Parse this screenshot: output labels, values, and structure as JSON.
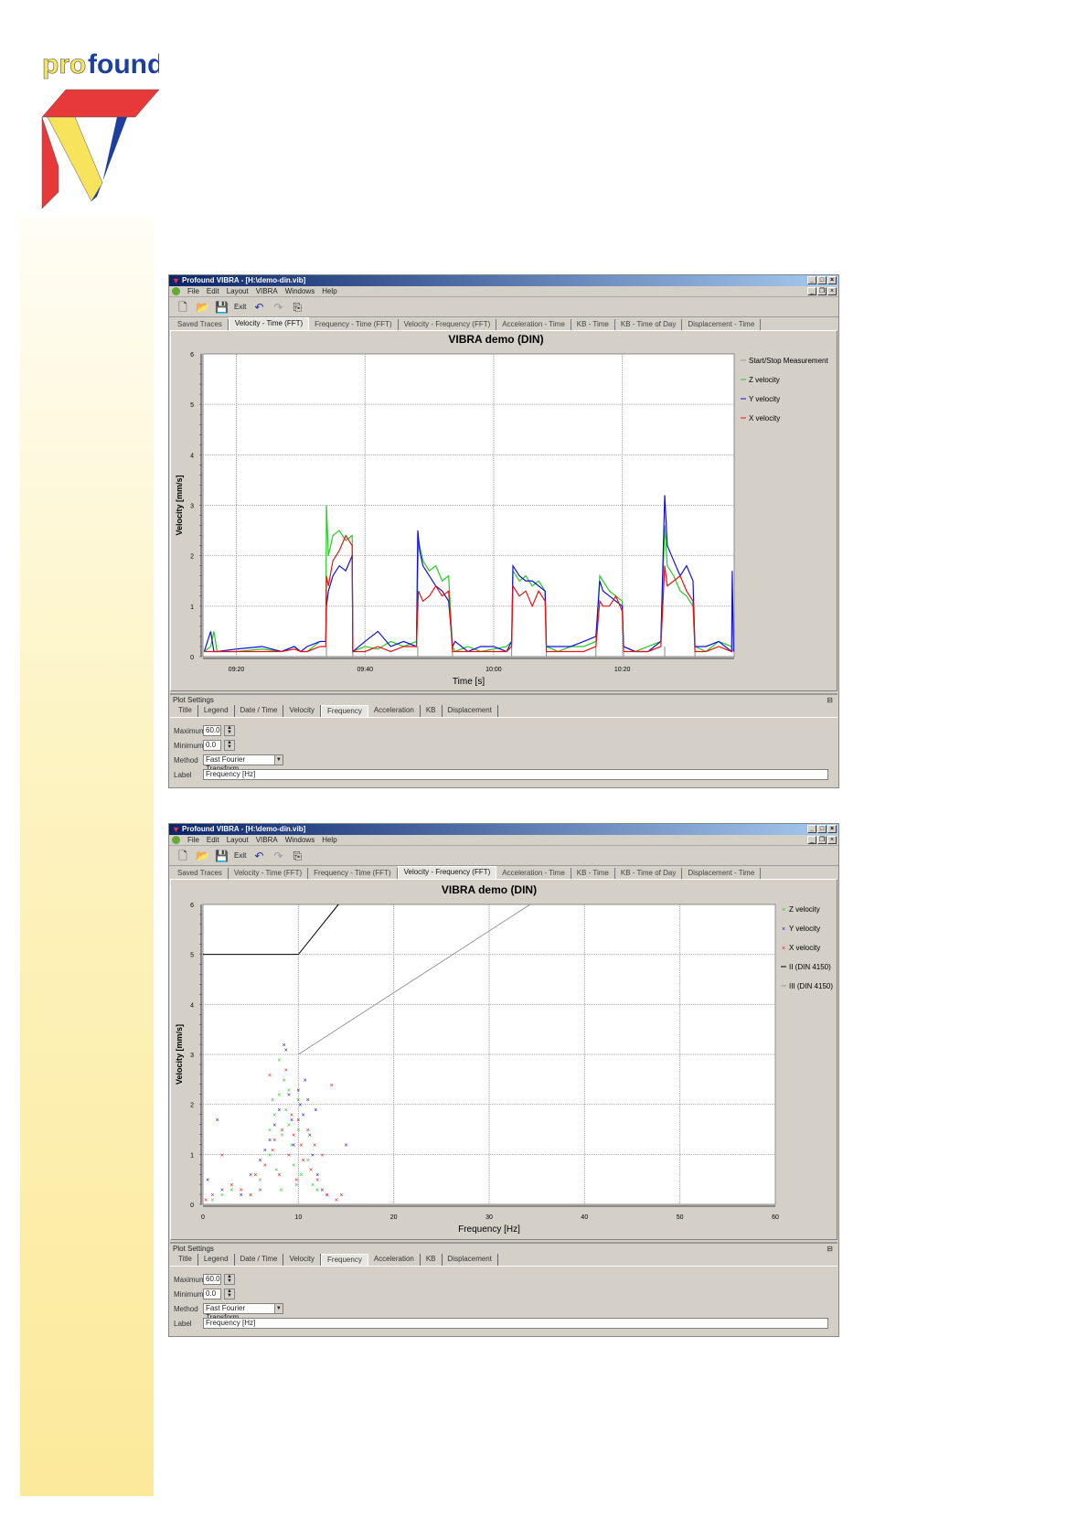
{
  "logo": {
    "text_pro": "pro",
    "text_found": "found"
  },
  "colors": {
    "z": "#22cc22",
    "y": "#1010dd",
    "x": "#ee1111",
    "title_bar": "#0a246a",
    "panel": "#d4d0c8"
  },
  "windows": [
    {
      "title": "Profound VIBRA - [H:\\demo-din.vib]",
      "menu": [
        "File",
        "Edit",
        "Layout",
        "VIBRA",
        "Windows",
        "Help"
      ],
      "toolbar": {
        "exit_label": "Exit"
      },
      "tabs": [
        "Saved Traces",
        "Velocity - Time (FFT)",
        "Frequency - Time (FFT)",
        "Velocity - Frequency (FFT)",
        "Acceleration - Time",
        "KB - Time",
        "KB - Time of Day",
        "Displacement - Time"
      ],
      "active_tab": 1,
      "plot_settings": {
        "header": "Plot Settings",
        "tabs": [
          "Title",
          "Legend",
          "Date / Time",
          "Velocity",
          "Frequency",
          "Acceleration",
          "KB",
          "Displacement"
        ],
        "active_tab": 4,
        "maximum_label": "Maximum",
        "maximum": "60.0",
        "minimum_label": "Minimum",
        "minimum": "0.0",
        "method_label": "Method",
        "method": "Fast Fourier Transform",
        "label_label": "Label",
        "label": "Frequency [Hz]"
      }
    },
    {
      "title": "Profound VIBRA - [H:\\demo-din.vib]",
      "menu": [
        "File",
        "Edit",
        "Layout",
        "VIBRA",
        "Windows",
        "Help"
      ],
      "toolbar": {
        "exit_label": "Exit"
      },
      "tabs": [
        "Saved Traces",
        "Velocity - Time (FFT)",
        "Frequency - Time (FFT)",
        "Velocity - Frequency (FFT)",
        "Acceleration - Time",
        "KB - Time",
        "KB - Time of Day",
        "Displacement - Time"
      ],
      "active_tab": 3,
      "plot_settings": {
        "header": "Plot Settings",
        "tabs": [
          "Title",
          "Legend",
          "Date / Time",
          "Velocity",
          "Frequency",
          "Acceleration",
          "KB",
          "Displacement"
        ],
        "active_tab": 4,
        "maximum_label": "Maximum",
        "maximum": "60.0",
        "minimum_label": "Minimum",
        "minimum": "0.0",
        "method_label": "Method",
        "method": "Fast Fourier Transform",
        "label_label": "Label",
        "label": "Frequency [Hz]"
      }
    }
  ],
  "chart_data": [
    {
      "type": "line",
      "title": "VIBRA demo (DIN)",
      "xlabel": "Time [s]",
      "ylabel": "Velocity [mm/s]",
      "xlim_minutes_after_0900": [
        14.8,
        97.4
      ],
      "ylim": [
        0,
        6
      ],
      "xticks": [
        {
          "label": "09:20",
          "value": 20
        },
        {
          "label": "09:40",
          "value": 40
        },
        {
          "label": "10:00",
          "value": 60
        },
        {
          "label": "10:20",
          "value": 80
        }
      ],
      "yticks": [
        0,
        1,
        2,
        3,
        4,
        5,
        6
      ],
      "grid": true,
      "legend_position": "right",
      "legend": [
        "Start/Stop Measurement",
        "Z velocity",
        "Y velocity",
        "X velocity"
      ],
      "series": [
        {
          "name": "Z velocity",
          "color": "#22cc22",
          "x": [
            15,
            16,
            16.5,
            17,
            20,
            24,
            27,
            29,
            30,
            31,
            33,
            33.9,
            34,
            34.3,
            35,
            36,
            37,
            38,
            38.1,
            40,
            42,
            44,
            46,
            48,
            48.3,
            49,
            50,
            51,
            52,
            53,
            53.6,
            54,
            56,
            58,
            60,
            62,
            62.8,
            63,
            64,
            65,
            66,
            67,
            68,
            68.2,
            70,
            72,
            74,
            75.9,
            76.5,
            77,
            78,
            79,
            80,
            80.2,
            82,
            84,
            86,
            86.6,
            87,
            88,
            89,
            90,
            91,
            91.3,
            93,
            95,
            97,
            97.1
          ],
          "y": [
            0.1,
            0.2,
            0.5,
            0.1,
            0.1,
            0.15,
            0.1,
            0.2,
            0.1,
            0.1,
            0.3,
            0.3,
            3.0,
            2.0,
            2.4,
            2.5,
            2.3,
            2.4,
            0.1,
            0.2,
            0.15,
            0.3,
            0.2,
            0.3,
            2.3,
            1.9,
            1.7,
            1.8,
            1.5,
            1.6,
            0.2,
            0.1,
            0.2,
            0.1,
            0.15,
            0.2,
            0.3,
            1.7,
            1.5,
            1.6,
            1.4,
            1.5,
            1.3,
            0.2,
            0.1,
            0.2,
            0.2,
            0.3,
            1.6,
            1.5,
            1.3,
            1.2,
            1.1,
            0.2,
            0.1,
            0.2,
            0.3,
            2.6,
            1.8,
            1.6,
            1.3,
            1.2,
            1.0,
            0.2,
            0.1,
            0.3,
            0.2,
            0.1
          ]
        },
        {
          "name": "Y velocity",
          "color": "#1010dd",
          "x": [
            15,
            16,
            16.5,
            17,
            20,
            24,
            27,
            29,
            30,
            31,
            33,
            33.9,
            34,
            34.3,
            35,
            36,
            37,
            38,
            38.1,
            40,
            42,
            44,
            46,
            48,
            48.2,
            48.5,
            49,
            50,
            51,
            52,
            53,
            53.6,
            54,
            56,
            58,
            60,
            62,
            62.8,
            63,
            64,
            65,
            66,
            67,
            68,
            68.2,
            70,
            72,
            74,
            75.9,
            76.5,
            77,
            78,
            79,
            80,
            80.2,
            82,
            84,
            86,
            86.6,
            87,
            88,
            89,
            90,
            91,
            91.3,
            93,
            95,
            97,
            97.1,
            97.3
          ],
          "y": [
            0.1,
            0.5,
            0.1,
            0.1,
            0.15,
            0.2,
            0.1,
            0.2,
            0.1,
            0.2,
            0.3,
            0.3,
            1.0,
            1.3,
            1.6,
            1.8,
            1.7,
            2.0,
            0.1,
            0.3,
            0.5,
            0.2,
            0.3,
            0.2,
            2.5,
            2.1,
            1.8,
            1.6,
            1.4,
            1.3,
            1.1,
            0.2,
            0.3,
            0.1,
            0.2,
            0.2,
            0.1,
            0.3,
            1.8,
            1.6,
            1.5,
            1.5,
            1.4,
            1.3,
            0.2,
            0.2,
            0.2,
            0.3,
            0.4,
            1.5,
            1.3,
            1.2,
            1.1,
            1.0,
            0.2,
            0.1,
            0.1,
            0.3,
            3.2,
            2.2,
            1.9,
            1.6,
            1.8,
            1.5,
            0.2,
            0.2,
            0.3,
            0.1,
            1.7,
            0.1
          ]
        },
        {
          "name": "X velocity",
          "color": "#ee1111",
          "x": [
            15,
            16,
            17,
            20,
            24,
            27,
            29,
            30,
            31,
            33,
            33.9,
            34,
            34.3,
            35,
            36,
            37,
            38,
            38.1,
            40,
            42,
            44,
            46,
            48,
            48.3,
            49,
            50,
            51,
            52,
            53,
            53.6,
            54,
            56,
            58,
            60,
            62,
            62.8,
            63,
            64,
            65,
            66,
            67,
            68,
            68.2,
            70,
            72,
            74,
            75.9,
            76.5,
            77,
            78,
            79,
            80,
            80.2,
            82,
            84,
            86,
            86.6,
            87,
            88,
            89,
            90,
            91,
            91.3,
            93,
            95,
            97,
            97.1
          ],
          "y": [
            0.1,
            0.1,
            0.1,
            0.1,
            0.1,
            0.1,
            0.15,
            0.1,
            0.1,
            0.2,
            0.2,
            1.6,
            1.4,
            1.9,
            2.1,
            2.4,
            2.2,
            0.1,
            0.1,
            0.2,
            0.1,
            0.2,
            0.2,
            1.3,
            1.1,
            1.2,
            1.4,
            1.2,
            1.3,
            0.1,
            0.1,
            0.1,
            0.1,
            0.1,
            0.1,
            0.2,
            1.4,
            1.2,
            1.3,
            1.0,
            1.3,
            1.1,
            0.1,
            0.1,
            0.1,
            0.1,
            0.2,
            1.1,
            1.0,
            1.0,
            1.2,
            0.9,
            0.1,
            0.1,
            0.1,
            0.2,
            1.8,
            1.4,
            1.5,
            1.6,
            1.3,
            1.1,
            0.1,
            0.1,
            0.2,
            0.1,
            0.1
          ]
        }
      ],
      "start_stop_markers": [
        34,
        38.1,
        48.2,
        53.6,
        62.8,
        68.2,
        75.9,
        80.2,
        86.6,
        91.3
      ]
    },
    {
      "type": "scatter",
      "title": "VIBRA demo (DIN)",
      "xlabel": "Frequency [Hz]",
      "ylabel": "Velocity [mm/s]",
      "xlim": [
        0,
        60
      ],
      "ylim": [
        0,
        6
      ],
      "xticks": [
        0,
        10,
        20,
        30,
        40,
        50,
        60
      ],
      "yticks": [
        0,
        1,
        2,
        3,
        4,
        5,
        6
      ],
      "grid": true,
      "legend_position": "right",
      "legend": [
        "Z velocity",
        "Y velocity",
        "X velocity",
        "II (DIN 4150)",
        "III (DIN 4150)"
      ],
      "series": [
        {
          "name": "Z velocity",
          "color": "#22cc22",
          "points": [
            [
              1,
              0.1
            ],
            [
              2,
              0.2
            ],
            [
              3,
              0.3
            ],
            [
              5,
              0.2
            ],
            [
              6,
              0.5
            ],
            [
              7,
              1.0
            ],
            [
              7,
              1.5
            ],
            [
              7.3,
              2.1
            ],
            [
              7.5,
              1.8
            ],
            [
              8,
              2.2
            ],
            [
              8,
              2.9
            ],
            [
              8.3,
              1.4
            ],
            [
              8.5,
              2.5
            ],
            [
              8.7,
              1.9
            ],
            [
              9,
              1.6
            ],
            [
              9,
              2.3
            ],
            [
              9.3,
              1.2
            ],
            [
              9.5,
              0.8
            ],
            [
              10,
              2.1
            ],
            [
              10,
              1.5
            ],
            [
              10.3,
              0.6
            ],
            [
              11,
              0.9
            ],
            [
              11.5,
              0.4
            ],
            [
              12,
              0.3
            ],
            [
              7.7,
              0.7
            ],
            [
              8.2,
              0.3
            ],
            [
              9.8,
              0.4
            ]
          ]
        },
        {
          "name": "Y velocity",
          "color": "#1010dd",
          "points": [
            [
              0.5,
              0.5
            ],
            [
              1.5,
              1.7
            ],
            [
              2,
              0.3
            ],
            [
              4,
              0.2
            ],
            [
              5,
              0.6
            ],
            [
              6,
              0.9
            ],
            [
              6.5,
              1.1
            ],
            [
              7,
              1.3
            ],
            [
              7.5,
              1.6
            ],
            [
              8,
              1.9
            ],
            [
              8.5,
              3.2
            ],
            [
              8.7,
              3.1
            ],
            [
              9,
              2.2
            ],
            [
              9.3,
              1.7
            ],
            [
              9.5,
              1.2
            ],
            [
              10,
              2.3
            ],
            [
              10.2,
              2.0
            ],
            [
              10.5,
              1.8
            ],
            [
              11,
              2.1
            ],
            [
              11.2,
              1.4
            ],
            [
              11.5,
              1.0
            ],
            [
              12,
              0.6
            ],
            [
              12.5,
              0.3
            ],
            [
              13,
              0.2
            ],
            [
              15,
              1.2
            ],
            [
              11.8,
              1.9
            ],
            [
              10.7,
              2.5
            ]
          ]
        },
        {
          "name": "X velocity",
          "color": "#ee1111",
          "points": [
            [
              0.3,
              0.1
            ],
            [
              1,
              0.2
            ],
            [
              2,
              1.0
            ],
            [
              3,
              0.4
            ],
            [
              4,
              0.3
            ],
            [
              5,
              0.2
            ],
            [
              5.5,
              0.6
            ],
            [
              6,
              0.3
            ],
            [
              6.5,
              0.8
            ],
            [
              7,
              2.6
            ],
            [
              7.3,
              1.1
            ],
            [
              7.5,
              1.3
            ],
            [
              8,
              0.6
            ],
            [
              8.3,
              1.5
            ],
            [
              8.7,
              2.7
            ],
            [
              9,
              1.0
            ],
            [
              9.3,
              1.8
            ],
            [
              9.5,
              1.4
            ],
            [
              9.8,
              0.5
            ],
            [
              10,
              1.7
            ],
            [
              10.3,
              1.2
            ],
            [
              10.5,
              0.9
            ],
            [
              11,
              1.5
            ],
            [
              11.3,
              0.7
            ],
            [
              11.7,
              1.2
            ],
            [
              12,
              0.5
            ],
            [
              12.5,
              1.0
            ],
            [
              13,
              0.2
            ],
            [
              13.5,
              2.4
            ],
            [
              14,
              0.1
            ],
            [
              14.5,
              0.2
            ]
          ]
        }
      ],
      "reference_lines": [
        {
          "name": "II (DIN 4150)",
          "color": "#000000",
          "points": [
            [
              0,
              5
            ],
            [
              10,
              5
            ],
            [
              14.2,
              6
            ]
          ]
        },
        {
          "name": "III (DIN 4150)",
          "color": "#888888",
          "points": [
            [
              10,
              3
            ],
            [
              34.3,
              6
            ]
          ]
        }
      ]
    }
  ]
}
